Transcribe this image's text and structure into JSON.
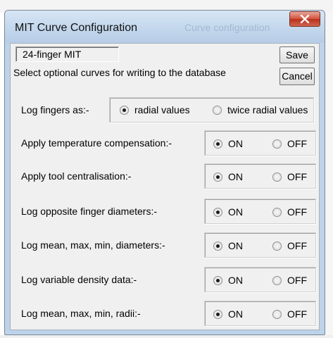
{
  "window": {
    "title": "MIT Curve Configuration",
    "background_title": "Curve configuration"
  },
  "tool_name": "24-finger MIT",
  "buttons": {
    "save": "Save",
    "cancel": "Cancel"
  },
  "instruction": "Select optional curves for writing to the database",
  "log_fingers": {
    "label": "Log fingers as:-",
    "options": [
      "radial values",
      "twice radial values"
    ],
    "selected": "radial values"
  },
  "options_on_label": "ON",
  "options_off_label": "OFF",
  "settings": [
    {
      "label": "Apply temperature compensation:-",
      "value": "ON"
    },
    {
      "label": "Apply tool centralisation:-",
      "value": "ON"
    },
    {
      "label": "Log opposite finger diameters:-",
      "value": "ON"
    },
    {
      "label": "Log mean, max, min, diameters:-",
      "value": "ON"
    },
    {
      "label": "Log variable density data:-",
      "value": "ON"
    },
    {
      "label": "Log mean, max, min, radii:-",
      "value": "ON"
    }
  ]
}
